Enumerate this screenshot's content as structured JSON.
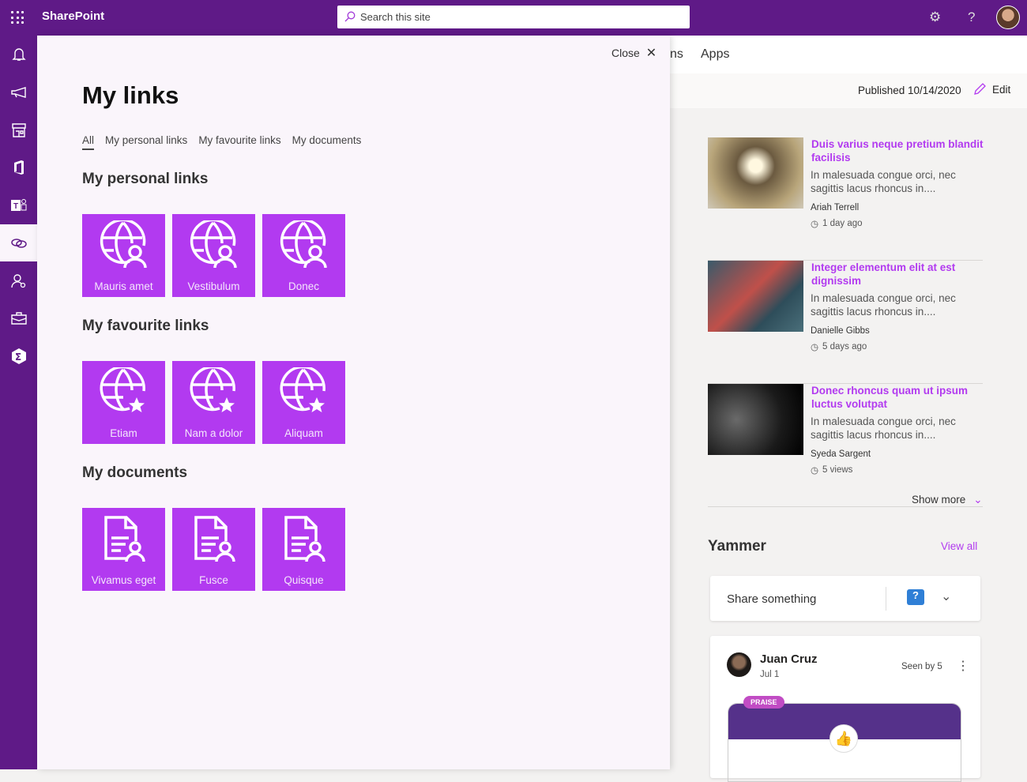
{
  "topbar": {
    "app_name": "SharePoint",
    "search_placeholder": "Search this site"
  },
  "rail": {
    "items": [
      {
        "icon": "bell-icon"
      },
      {
        "icon": "megaphone-icon"
      },
      {
        "icon": "store-icon"
      },
      {
        "icon": "office-icon"
      },
      {
        "icon": "teams-icon"
      },
      {
        "icon": "links-icon",
        "active": true
      },
      {
        "icon": "people-search-icon"
      },
      {
        "icon": "briefcase-icon"
      },
      {
        "icon": "sigma-icon"
      }
    ]
  },
  "panel": {
    "close_label": "Close",
    "title": "My links",
    "tabs": [
      "All",
      "My personal links",
      "My favourite links",
      "My documents"
    ],
    "sections": [
      {
        "heading": "My personal links",
        "tiles": [
          "Mauris amet",
          "Vestibulum",
          "Donec"
        ]
      },
      {
        "heading": "My favourite links",
        "tiles": [
          "Etiam",
          "Nam a dolor",
          "Aliquam"
        ]
      },
      {
        "heading": "My documents",
        "tiles": [
          "Vivamus eget",
          "Fusce",
          "Quisque"
        ]
      }
    ]
  },
  "site": {
    "nav_partial": "ns",
    "nav_apps": "Apps",
    "published": "Published 10/14/2020",
    "edit_label": "Edit",
    "news": [
      {
        "title": "Duis varius neque pretium blandit facilisis",
        "desc": "In malesuada congue orci, nec sagittis lacus rhoncus in....",
        "author": "Ariah Terrell",
        "meta": "1 day ago"
      },
      {
        "title": "Integer elementum elit at est dignissim",
        "desc": "In malesuada congue orci, nec sagittis lacus rhoncus in....",
        "author": "Danielle Gibbs",
        "meta": "5 days ago"
      },
      {
        "title": "Donec rhoncus quam ut ipsum luctus volutpat",
        "desc": "In malesuada congue orci, nec sagittis lacus rhoncus in....",
        "author": "Syeda Sargent",
        "meta": "5 views"
      }
    ],
    "show_more": "Show more",
    "yammer": {
      "title": "Yammer",
      "view_all": "View all",
      "share_placeholder": "Share something",
      "post": {
        "author": "Juan Cruz",
        "date": "Jul 1",
        "seen": "Seen by 5",
        "badge": "PRAISE"
      }
    }
  },
  "colors": {
    "brand": "#5f1a87",
    "tile": "#b23af0",
    "link": "#b23af0"
  }
}
